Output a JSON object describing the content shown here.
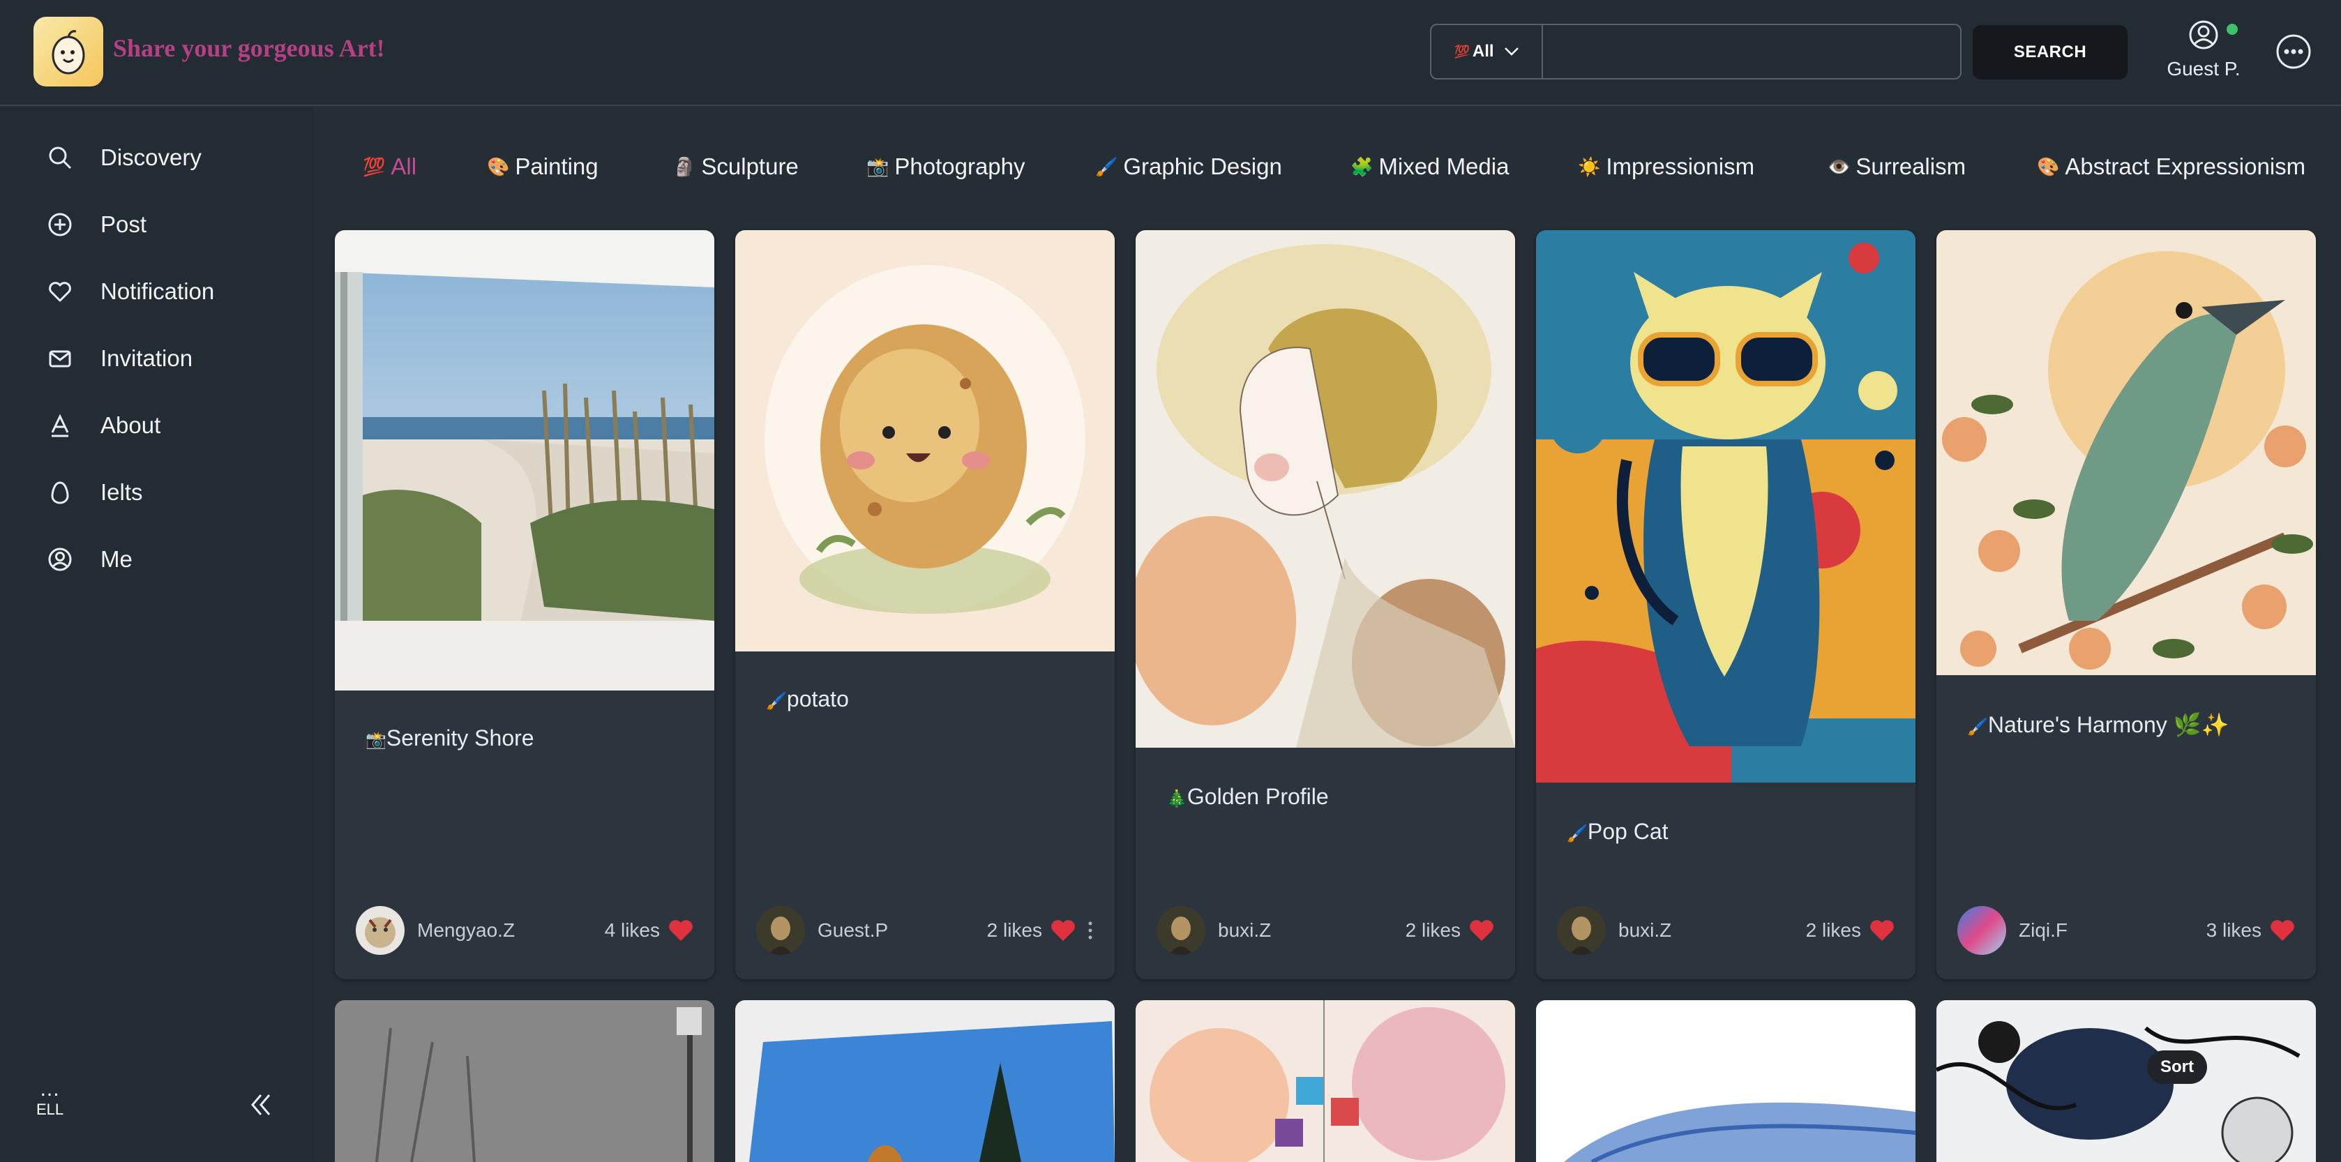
{
  "brand": {
    "title": "Share your gorgeous Art!"
  },
  "search": {
    "scope": "All",
    "scope_emoji": "💯",
    "query": "",
    "button": "SEARCH"
  },
  "user": {
    "name": "Guest P."
  },
  "sidebar": {
    "items": [
      {
        "label": "Discovery",
        "icon": "search-icon"
      },
      {
        "label": "Post",
        "icon": "plus-circle-icon"
      },
      {
        "label": "Notification",
        "icon": "heart-icon"
      },
      {
        "label": "Invitation",
        "icon": "mail-icon"
      },
      {
        "label": "About",
        "icon": "about-icon"
      },
      {
        "label": "Ielts",
        "icon": "egg-icon"
      },
      {
        "label": "Me",
        "icon": "user-circle-icon"
      }
    ],
    "footer_dots": "...",
    "footer_lang": "ELL"
  },
  "categories": [
    {
      "emoji": "💯",
      "label": "All"
    },
    {
      "emoji": "🎨",
      "label": "Painting"
    },
    {
      "emoji": "🗿",
      "label": "Sculpture"
    },
    {
      "emoji": "📸",
      "label": "Photography"
    },
    {
      "emoji": "🖌️",
      "label": "Graphic Design"
    },
    {
      "emoji": "🧩",
      "label": "Mixed Media"
    },
    {
      "emoji": "☀️",
      "label": "Impressionism"
    },
    {
      "emoji": "👁️",
      "label": "Surrealism"
    },
    {
      "emoji": "🎨",
      "label": "Abstract Expressionism"
    }
  ],
  "cards": [
    {
      "emoji": "📸",
      "title": "Serenity Shore",
      "author": "Mengyao.Z",
      "likes": "4 likes"
    },
    {
      "emoji": "🖌️",
      "title": "potato",
      "author": "Guest.P",
      "likes": "2 likes"
    },
    {
      "emoji": "🎄",
      "title": "Golden Profile",
      "author": "buxi.Z",
      "likes": "2 likes"
    },
    {
      "emoji": "🖌️",
      "title": "Pop Cat",
      "author": "buxi.Z",
      "likes": "2 likes"
    },
    {
      "emoji": "🖌️",
      "title": "Nature's Harmony 🌿✨",
      "author": "Ziqi.F",
      "likes": "3 likes"
    }
  ],
  "sort_label": "Sort",
  "colors": {
    "accent": "#c54a98",
    "brand": "#b63f86",
    "like": "#e0323e",
    "bg": "#252d35"
  }
}
